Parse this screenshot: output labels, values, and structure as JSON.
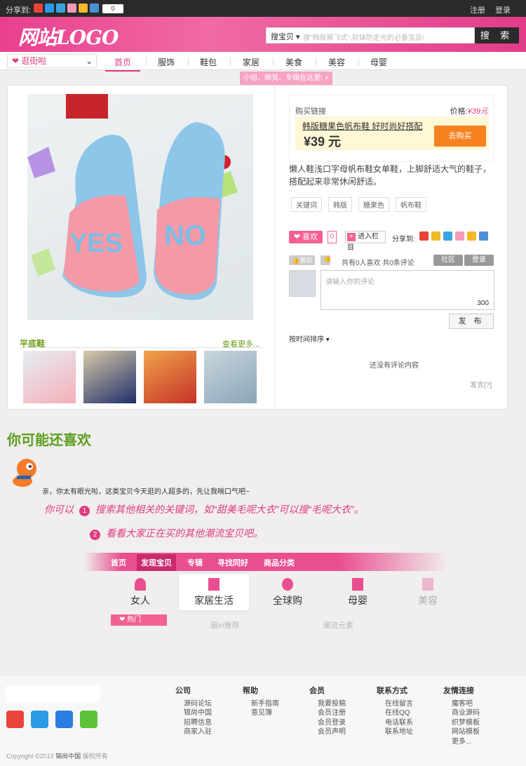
{
  "topbar": {
    "share_label": "分享到:",
    "count": "0",
    "register": "注册",
    "login": "登录"
  },
  "header": {
    "logo": "网站LOGO",
    "search_select": "搜宝贝",
    "search_placeholder": "搜\"韩版裤飞式\",软妹防走光的必备宝品!",
    "search_button": "搜 索"
  },
  "nav": {
    "dropdown": "逛街啦",
    "items": [
      "首页",
      "服饰",
      "鞋包",
      "家居",
      "美食",
      "美容",
      "母婴"
    ]
  },
  "tip": "小组、晒货、专辑在这里!",
  "product": {
    "flat_label": "平底鞋",
    "see_more": "查看更多...",
    "buy_label": "购买链接",
    "price_label": "价格:",
    "price_value": "¥39元",
    "name": "韩版糖果色帆布鞋 好时尚好搭配",
    "price_big": "¥39 元",
    "buy_button": "去购买",
    "description": "懒人鞋浅口字母帆布鞋女单鞋，上脚舒适大气的鞋子，搭配起来非常休闲舒适。",
    "tags": [
      "关键词",
      "韩版",
      "糖果色",
      "帆布鞋"
    ],
    "like_button": "喜欢",
    "like_count": "0",
    "add_column": "进入栏目",
    "share_label": "分享到:",
    "mini_like": "喜欢",
    "like_info": "共有0人喜欢 共0条评论",
    "community_button": "社区",
    "login_button": "登录",
    "comment_placeholder": "请输入你的评论",
    "comment_limit": "300",
    "publish_button": "发 布",
    "sort_label": "按时间排序",
    "no_comments": "还没有评论内容",
    "help_link": "发言[?]"
  },
  "recommend": {
    "title": "你可能还喜欢",
    "message": "亲，你太有眼光啦，这类宝贝今天逛的人超多的，先让我喘口气吧~",
    "hint1_prefix": "你可以",
    "hint1_num": "1",
    "hint1_text": "搜索其他相关的关键词，如“甜美毛呢大衣”可以搜“毛呢大衣”。",
    "hint2_num": "2",
    "hint2_text": "看看大家正在买的其他潮流宝贝吧。",
    "mock_tabs": [
      "首页",
      "发现宝贝",
      "专辑",
      "寻找同好",
      "商品分类"
    ],
    "mock_cats": [
      "女人",
      "家居生活",
      "全球购",
      "母婴",
      "美容"
    ],
    "hot_label": "热门",
    "faint_labels": [
      "最in推荐",
      "潮流元素"
    ]
  },
  "footer": {
    "columns": [
      {
        "title": "公司",
        "links": [
          "源码论坛",
          "锦尚中国",
          "招聘信息",
          "商家入驻"
        ]
      },
      {
        "title": "帮助",
        "links": [
          "新手指南",
          "意见簿"
        ]
      },
      {
        "title": "会员",
        "links": [
          "我要投稿",
          "会员注册",
          "会员登录",
          "会员声明"
        ]
      },
      {
        "title": "联系方式",
        "links": [
          "在线留言",
          "在线QQ",
          "电话联系",
          "联系地址"
        ]
      },
      {
        "title": "友情连接",
        "links": [
          "魔客吧",
          "商业源码",
          "织梦模板",
          "网站模板",
          "更多..."
        ]
      }
    ],
    "copyright_prefix": "Copyright ©2013",
    "copyright_brand": "锦尚中国",
    "copyright_suffix": "版权所有"
  },
  "colors": {
    "brand_pink": "#e9408e",
    "green": "#6e9e1d",
    "orange": "#f5821f"
  }
}
